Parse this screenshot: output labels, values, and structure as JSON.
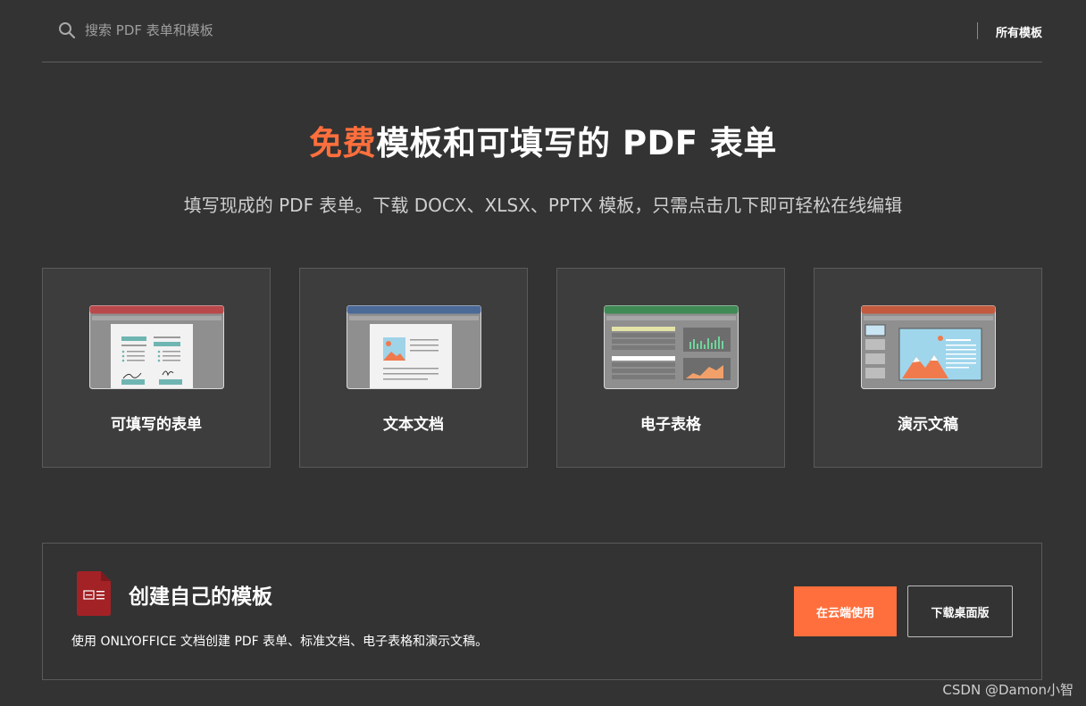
{
  "header": {
    "search_placeholder": "搜索 PDF 表单和模板",
    "all_templates_label": "所有模板",
    "search_icon": "search-icon"
  },
  "hero": {
    "title_accent": "免费",
    "title_rest": "模板和可填写的 PDF 表单",
    "subtitle": "填写现成的 PDF 表单。下载 DOCX、XLSX、PPTX 模板，只需点击几下即可轻松在线编辑",
    "accent_color": "#ff6f3d"
  },
  "categories": [
    {
      "label": "可填写的表单",
      "icon": "fillable-form-icon",
      "color": "#b9484b"
    },
    {
      "label": "文本文档",
      "icon": "text-document-icon",
      "color": "#4b6a98"
    },
    {
      "label": "电子表格",
      "icon": "spreadsheet-icon",
      "color": "#3f8a55"
    },
    {
      "label": "演示文稿",
      "icon": "presentation-icon",
      "color": "#c35a3e"
    }
  ],
  "create": {
    "title": "创建自己的模板",
    "description": "使用 ONLYOFFICE 文档创建 PDF 表单、标准文档、电子表格和演示文稿。",
    "cloud_button": "在云端使用",
    "desktop_button": "下载桌面版",
    "icon": "pdf-form-document-icon",
    "icon_color": "#a32226"
  },
  "watermark": "CSDN @Damon小智"
}
